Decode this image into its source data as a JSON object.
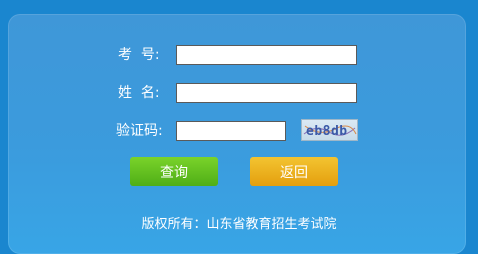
{
  "form": {
    "exam_number_label": "考  号:",
    "name_label": "姓  名:",
    "captcha_label": "验证码:",
    "exam_number_value": "",
    "name_value": "",
    "captcha_value": "",
    "captcha_text": "eb8db"
  },
  "buttons": {
    "query": "查询",
    "back": "返回"
  },
  "footer": {
    "copyright": "版权所有：山东省教育招生考试院"
  },
  "colors": {
    "page_bg": "#1a86cf",
    "panel_bg": "#3b9bdd",
    "query_button": "#5fbf1e",
    "back_button": "#eab21f"
  }
}
